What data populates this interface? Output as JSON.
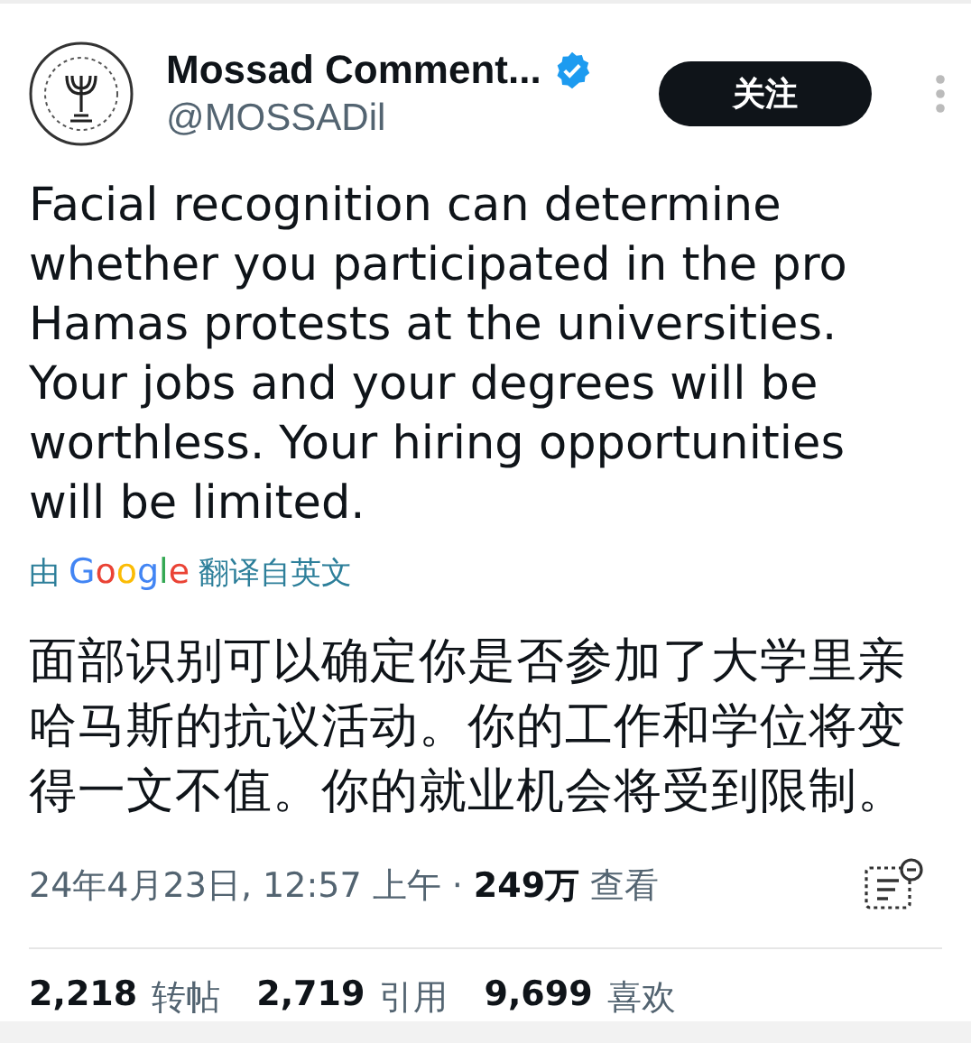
{
  "author": {
    "name": "Mossad Comment...",
    "verified": true,
    "handle": "@MOSSADil"
  },
  "follow_button": {
    "label": "关注"
  },
  "tweet_text": "Facial recognition can determine whether you participated in the pro Hamas protests at the universities. Your jobs and your degrees will be worthless. Your hiring opportunities will be limited.",
  "translation_note": {
    "prefix": "由",
    "brand": "Google",
    "suffix": "翻译自英文"
  },
  "translated_text": "面部识别可以确定你是否参加了大学里亲哈马斯的抗议活动。你的工作和学位将变得一文不值。你的就业机会将受到限制。",
  "meta": {
    "timestamp": "24年4月23日, 12:57 上午",
    "separator": "·",
    "views_count": "249万",
    "views_label": "查看"
  },
  "stats": [
    {
      "count": "2,218",
      "label": "转帖"
    },
    {
      "count": "2,719",
      "label": "引用"
    },
    {
      "count": "9,699",
      "label": "喜欢"
    }
  ]
}
